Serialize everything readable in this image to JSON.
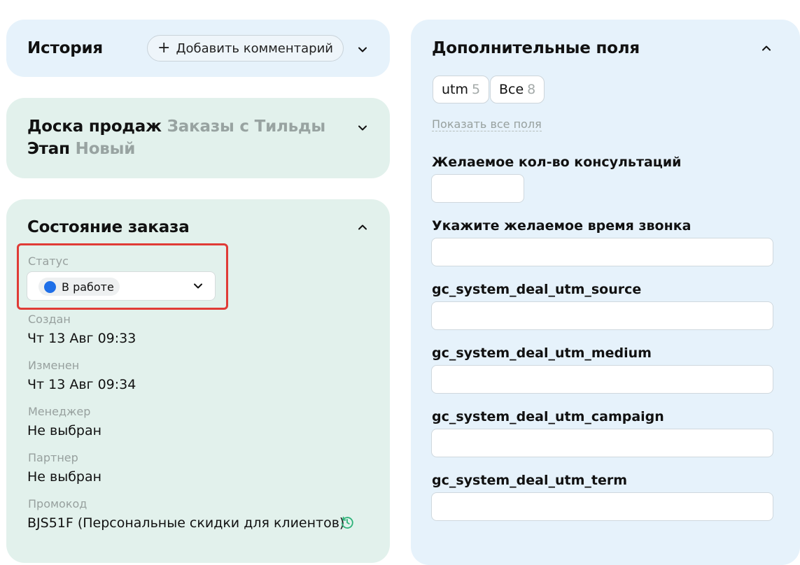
{
  "history": {
    "title": "История",
    "add_comment_label": "Добавить комментарий"
  },
  "board": {
    "board_label": "Доска продаж",
    "board_value": "Заказы с Тильды",
    "stage_label": "Этап",
    "stage_value": "Новый"
  },
  "order_state": {
    "title": "Состояние заказа",
    "status_label": "Статус",
    "status_value": "В работе",
    "status_color": "#1f6fe8",
    "created_label": "Создан",
    "created_value": "Чт 13 Авг 09:33",
    "modified_label": "Изменен",
    "modified_value": "Чт 13 Авг 09:34",
    "manager_label": "Менеджер",
    "manager_value": "Не выбран",
    "partner_label": "Партнер",
    "partner_value": "Не выбран",
    "promo_label": "Промокод",
    "promo_value": "BJS51F (Персональные скидки для клиентов)"
  },
  "extra_fields": {
    "title": "Дополнительные поля",
    "tags": [
      {
        "label": "utm",
        "count": "5"
      },
      {
        "label": "Все",
        "count": "8"
      }
    ],
    "show_all_label": "Показать все поля",
    "fields": [
      {
        "label": "Желаемое кол-во консультаций",
        "value": ""
      },
      {
        "label": "Укажите желаемое время звонка",
        "value": ""
      },
      {
        "label": "gc_system_deal_utm_source",
        "value": ""
      },
      {
        "label": "gc_system_deal_utm_medium",
        "value": ""
      },
      {
        "label": "gc_system_deal_utm_campaign",
        "value": ""
      },
      {
        "label": "gc_system_deal_utm_term",
        "value": ""
      }
    ]
  },
  "colors": {
    "blue_card": "#e6f2fb",
    "green_card": "#e2f1ec",
    "highlight": "#e03b36",
    "history_icon": "#2fb37a"
  }
}
